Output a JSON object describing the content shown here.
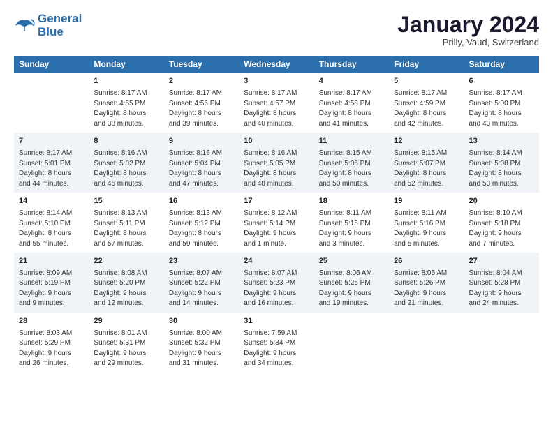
{
  "logo": {
    "line1": "General",
    "line2": "Blue"
  },
  "title": "January 2024",
  "subtitle": "Prilly, Vaud, Switzerland",
  "columns": [
    "Sunday",
    "Monday",
    "Tuesday",
    "Wednesday",
    "Thursday",
    "Friday",
    "Saturday"
  ],
  "weeks": [
    [
      {
        "day": "",
        "detail": ""
      },
      {
        "day": "1",
        "detail": "Sunrise: 8:17 AM\nSunset: 4:55 PM\nDaylight: 8 hours\nand 38 minutes."
      },
      {
        "day": "2",
        "detail": "Sunrise: 8:17 AM\nSunset: 4:56 PM\nDaylight: 8 hours\nand 39 minutes."
      },
      {
        "day": "3",
        "detail": "Sunrise: 8:17 AM\nSunset: 4:57 PM\nDaylight: 8 hours\nand 40 minutes."
      },
      {
        "day": "4",
        "detail": "Sunrise: 8:17 AM\nSunset: 4:58 PM\nDaylight: 8 hours\nand 41 minutes."
      },
      {
        "day": "5",
        "detail": "Sunrise: 8:17 AM\nSunset: 4:59 PM\nDaylight: 8 hours\nand 42 minutes."
      },
      {
        "day": "6",
        "detail": "Sunrise: 8:17 AM\nSunset: 5:00 PM\nDaylight: 8 hours\nand 43 minutes."
      }
    ],
    [
      {
        "day": "7",
        "detail": "Sunrise: 8:17 AM\nSunset: 5:01 PM\nDaylight: 8 hours\nand 44 minutes."
      },
      {
        "day": "8",
        "detail": "Sunrise: 8:16 AM\nSunset: 5:02 PM\nDaylight: 8 hours\nand 46 minutes."
      },
      {
        "day": "9",
        "detail": "Sunrise: 8:16 AM\nSunset: 5:04 PM\nDaylight: 8 hours\nand 47 minutes."
      },
      {
        "day": "10",
        "detail": "Sunrise: 8:16 AM\nSunset: 5:05 PM\nDaylight: 8 hours\nand 48 minutes."
      },
      {
        "day": "11",
        "detail": "Sunrise: 8:15 AM\nSunset: 5:06 PM\nDaylight: 8 hours\nand 50 minutes."
      },
      {
        "day": "12",
        "detail": "Sunrise: 8:15 AM\nSunset: 5:07 PM\nDaylight: 8 hours\nand 52 minutes."
      },
      {
        "day": "13",
        "detail": "Sunrise: 8:14 AM\nSunset: 5:08 PM\nDaylight: 8 hours\nand 53 minutes."
      }
    ],
    [
      {
        "day": "14",
        "detail": "Sunrise: 8:14 AM\nSunset: 5:10 PM\nDaylight: 8 hours\nand 55 minutes."
      },
      {
        "day": "15",
        "detail": "Sunrise: 8:13 AM\nSunset: 5:11 PM\nDaylight: 8 hours\nand 57 minutes."
      },
      {
        "day": "16",
        "detail": "Sunrise: 8:13 AM\nSunset: 5:12 PM\nDaylight: 8 hours\nand 59 minutes."
      },
      {
        "day": "17",
        "detail": "Sunrise: 8:12 AM\nSunset: 5:14 PM\nDaylight: 9 hours\nand 1 minute."
      },
      {
        "day": "18",
        "detail": "Sunrise: 8:11 AM\nSunset: 5:15 PM\nDaylight: 9 hours\nand 3 minutes."
      },
      {
        "day": "19",
        "detail": "Sunrise: 8:11 AM\nSunset: 5:16 PM\nDaylight: 9 hours\nand 5 minutes."
      },
      {
        "day": "20",
        "detail": "Sunrise: 8:10 AM\nSunset: 5:18 PM\nDaylight: 9 hours\nand 7 minutes."
      }
    ],
    [
      {
        "day": "21",
        "detail": "Sunrise: 8:09 AM\nSunset: 5:19 PM\nDaylight: 9 hours\nand 9 minutes."
      },
      {
        "day": "22",
        "detail": "Sunrise: 8:08 AM\nSunset: 5:20 PM\nDaylight: 9 hours\nand 12 minutes."
      },
      {
        "day": "23",
        "detail": "Sunrise: 8:07 AM\nSunset: 5:22 PM\nDaylight: 9 hours\nand 14 minutes."
      },
      {
        "day": "24",
        "detail": "Sunrise: 8:07 AM\nSunset: 5:23 PM\nDaylight: 9 hours\nand 16 minutes."
      },
      {
        "day": "25",
        "detail": "Sunrise: 8:06 AM\nSunset: 5:25 PM\nDaylight: 9 hours\nand 19 minutes."
      },
      {
        "day": "26",
        "detail": "Sunrise: 8:05 AM\nSunset: 5:26 PM\nDaylight: 9 hours\nand 21 minutes."
      },
      {
        "day": "27",
        "detail": "Sunrise: 8:04 AM\nSunset: 5:28 PM\nDaylight: 9 hours\nand 24 minutes."
      }
    ],
    [
      {
        "day": "28",
        "detail": "Sunrise: 8:03 AM\nSunset: 5:29 PM\nDaylight: 9 hours\nand 26 minutes."
      },
      {
        "day": "29",
        "detail": "Sunrise: 8:01 AM\nSunset: 5:31 PM\nDaylight: 9 hours\nand 29 minutes."
      },
      {
        "day": "30",
        "detail": "Sunrise: 8:00 AM\nSunset: 5:32 PM\nDaylight: 9 hours\nand 31 minutes."
      },
      {
        "day": "31",
        "detail": "Sunrise: 7:59 AM\nSunset: 5:34 PM\nDaylight: 9 hours\nand 34 minutes."
      },
      {
        "day": "",
        "detail": ""
      },
      {
        "day": "",
        "detail": ""
      },
      {
        "day": "",
        "detail": ""
      }
    ]
  ]
}
